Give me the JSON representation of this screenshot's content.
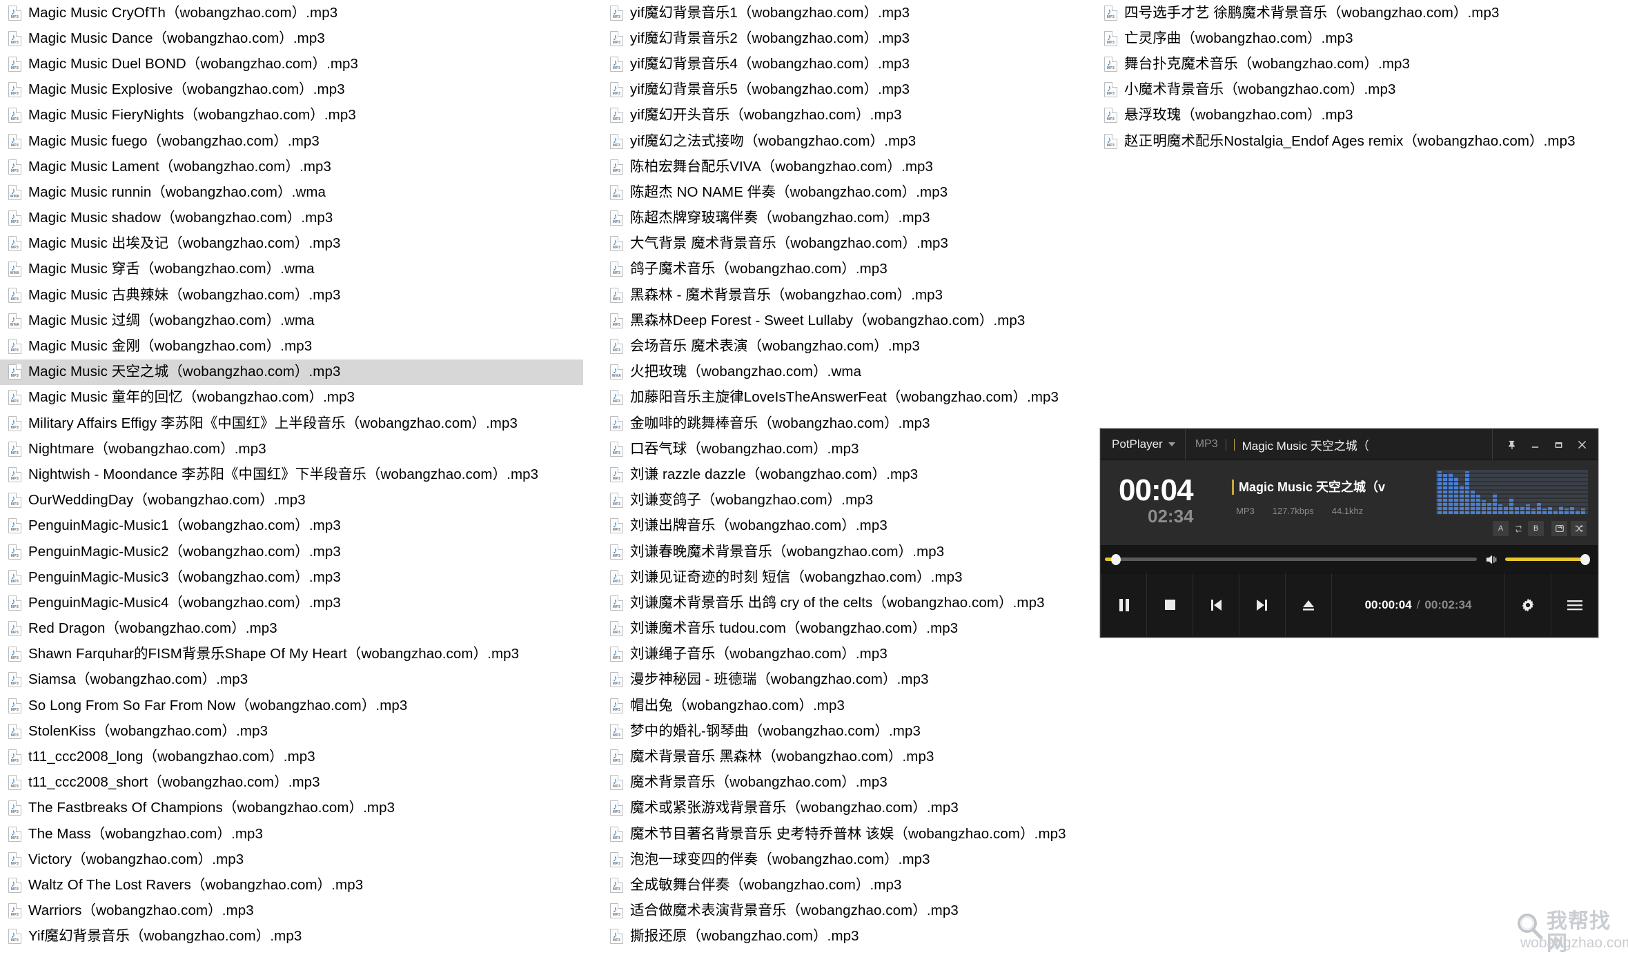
{
  "window": {
    "background_color": "#ffffff",
    "selection_color": "#d7d7d7",
    "text_color": "#000000"
  },
  "file_list": {
    "columns": [
      {
        "name": "column-1",
        "files": [
          {
            "name": "Magic Music CryOfTh（wobangzhao.com）.mp3",
            "format": "MP3",
            "selected": false
          },
          {
            "name": "Magic Music Dance（wobangzhao.com）.mp3",
            "format": "MP3",
            "selected": false
          },
          {
            "name": "Magic Music Duel BOND（wobangzhao.com）.mp3",
            "format": "MP3",
            "selected": false
          },
          {
            "name": "Magic Music Explosive（wobangzhao.com）.mp3",
            "format": "MP3",
            "selected": false
          },
          {
            "name": "Magic Music FieryNights（wobangzhao.com）.mp3",
            "format": "MP3",
            "selected": false
          },
          {
            "name": "Magic Music fuego（wobangzhao.com）.mp3",
            "format": "MP3",
            "selected": false
          },
          {
            "name": "Magic Music Lament（wobangzhao.com）.mp3",
            "format": "MP3",
            "selected": false
          },
          {
            "name": "Magic Music runnin（wobangzhao.com）.wma",
            "format": "WMA",
            "selected": false
          },
          {
            "name": "Magic Music shadow（wobangzhao.com）.mp3",
            "format": "MP3",
            "selected": false
          },
          {
            "name": "Magic Music 出埃及记（wobangzhao.com）.mp3",
            "format": "MP3",
            "selected": false
          },
          {
            "name": "Magic Music 穿舌（wobangzhao.com）.wma",
            "format": "WMA",
            "selected": false
          },
          {
            "name": "Magic Music 古典辣妹（wobangzhao.com）.mp3",
            "format": "MP3",
            "selected": false
          },
          {
            "name": "Magic Music 过绸（wobangzhao.com）.wma",
            "format": "WMA",
            "selected": false
          },
          {
            "name": "Magic Music 金刚（wobangzhao.com）.mp3",
            "format": "MP3",
            "selected": false
          },
          {
            "name": "Magic Music 天空之城（wobangzhao.com）.mp3",
            "format": "MP3",
            "selected": true
          },
          {
            "name": "Magic Music 童年的回忆（wobangzhao.com）.mp3",
            "format": "MP3",
            "selected": false
          },
          {
            "name": "Military Affairs Effigy 李苏阳《中国红》上半段音乐（wobangzhao.com）.mp3",
            "format": "MP3",
            "selected": false
          },
          {
            "name": "Nightmare（wobangzhao.com）.mp3",
            "format": "MP3",
            "selected": false
          },
          {
            "name": "Nightwish - Moondance 李苏阳《中国红》下半段音乐（wobangzhao.com）.mp3",
            "format": "MP3",
            "selected": false
          },
          {
            "name": "OurWeddingDay（wobangzhao.com）.mp3",
            "format": "MP3",
            "selected": false
          },
          {
            "name": "PenguinMagic-Music1（wobangzhao.com）.mp3",
            "format": "MP3",
            "selected": false
          },
          {
            "name": "PenguinMagic-Music2（wobangzhao.com）.mp3",
            "format": "MP3",
            "selected": false
          },
          {
            "name": "PenguinMagic-Music3（wobangzhao.com）.mp3",
            "format": "MP3",
            "selected": false
          },
          {
            "name": "PenguinMagic-Music4（wobangzhao.com）.mp3",
            "format": "MP3",
            "selected": false
          },
          {
            "name": "Red Dragon（wobangzhao.com）.mp3",
            "format": "MP3",
            "selected": false
          },
          {
            "name": "Shawn Farquhar的FISM背景乐Shape Of My Heart（wobangzhao.com）.mp3",
            "format": "MP3",
            "selected": false
          },
          {
            "name": "Siamsa（wobangzhao.com）.mp3",
            "format": "MP3",
            "selected": false
          },
          {
            "name": "So Long From So Far From Now（wobangzhao.com）.mp3",
            "format": "MP3",
            "selected": false
          },
          {
            "name": "StolenKiss（wobangzhao.com）.mp3",
            "format": "MP3",
            "selected": false
          },
          {
            "name": "t11_ccc2008_long（wobangzhao.com）.mp3",
            "format": "MP3",
            "selected": false
          },
          {
            "name": "t11_ccc2008_short（wobangzhao.com）.mp3",
            "format": "MP3",
            "selected": false
          },
          {
            "name": "The Fastbreaks Of Champions（wobangzhao.com）.mp3",
            "format": "MP3",
            "selected": false
          },
          {
            "name": "The Mass（wobangzhao.com）.mp3",
            "format": "MP3",
            "selected": false
          },
          {
            "name": "Victory（wobangzhao.com）.mp3",
            "format": "MP3",
            "selected": false
          },
          {
            "name": "Waltz Of The Lost Ravers（wobangzhao.com）.mp3",
            "format": "MP3",
            "selected": false
          },
          {
            "name": "Warriors（wobangzhao.com）.mp3",
            "format": "MP3",
            "selected": false
          },
          {
            "name": "Yif魔幻背景音乐（wobangzhao.com）.mp3",
            "format": "MP3",
            "selected": false
          }
        ]
      },
      {
        "name": "column-2",
        "files": [
          {
            "name": "yif魔幻背景音乐1（wobangzhao.com）.mp3",
            "format": "MP3",
            "selected": false
          },
          {
            "name": "yif魔幻背景音乐2（wobangzhao.com）.mp3",
            "format": "MP3",
            "selected": false
          },
          {
            "name": "yif魔幻背景音乐4（wobangzhao.com）.mp3",
            "format": "MP3",
            "selected": false
          },
          {
            "name": "yif魔幻背景音乐5（wobangzhao.com）.mp3",
            "format": "MP3",
            "selected": false
          },
          {
            "name": "yif魔幻开头音乐（wobangzhao.com）.mp3",
            "format": "MP3",
            "selected": false
          },
          {
            "name": "yif魔幻之法式接吻（wobangzhao.com）.mp3",
            "format": "MP3",
            "selected": false
          },
          {
            "name": "陈柏宏舞台配乐VIVA（wobangzhao.com）.mp3",
            "format": "MP3",
            "selected": false
          },
          {
            "name": "陈超杰 NO NAME 伴奏（wobangzhao.com）.mp3",
            "format": "MP3",
            "selected": false
          },
          {
            "name": "陈超杰牌穿玻璃伴奏（wobangzhao.com）.mp3",
            "format": "MP3",
            "selected": false
          },
          {
            "name": "大气背景 魔术背景音乐（wobangzhao.com）.mp3",
            "format": "MP3",
            "selected": false
          },
          {
            "name": "鸽子魔术音乐（wobangzhao.com）.mp3",
            "format": "MP3",
            "selected": false
          },
          {
            "name": "黑森林 - 魔术背景音乐（wobangzhao.com）.mp3",
            "format": "MP3",
            "selected": false
          },
          {
            "name": "黑森林Deep Forest - Sweet Lullaby（wobangzhao.com）.mp3",
            "format": "MP3",
            "selected": false
          },
          {
            "name": "会场音乐 魔术表演（wobangzhao.com）.mp3",
            "format": "MP3",
            "selected": false
          },
          {
            "name": "火把玫瑰（wobangzhao.com）.wma",
            "format": "WMA",
            "selected": false
          },
          {
            "name": "加藤阳音乐主旋律LoveIsTheAnswerFeat（wobangzhao.com）.mp3",
            "format": "MP3",
            "selected": false
          },
          {
            "name": "金咖啡的跳舞棒音乐（wobangzhao.com）.mp3",
            "format": "MP3",
            "selected": false
          },
          {
            "name": "口吞气球（wobangzhao.com）.mp3",
            "format": "MP3",
            "selected": false
          },
          {
            "name": "刘谦 razzle dazzle（wobangzhao.com）.mp3",
            "format": "MP3",
            "selected": false
          },
          {
            "name": "刘谦变鸽子（wobangzhao.com）.mp3",
            "format": "MP3",
            "selected": false
          },
          {
            "name": "刘谦出牌音乐（wobangzhao.com）.mp3",
            "format": "MP3",
            "selected": false
          },
          {
            "name": "刘谦春晚魔术背景音乐（wobangzhao.com）.mp3",
            "format": "MP3",
            "selected": false
          },
          {
            "name": "刘谦见证奇迹的时刻 短信（wobangzhao.com）.mp3",
            "format": "MP3",
            "selected": false
          },
          {
            "name": "刘谦魔术背景音乐 出鸽 cry of the celts（wobangzhao.com）.mp3",
            "format": "MP3",
            "selected": false
          },
          {
            "name": "刘谦魔术音乐 tudou.com（wobangzhao.com）.mp3",
            "format": "MP3",
            "selected": false
          },
          {
            "name": "刘谦绳子音乐（wobangzhao.com）.mp3",
            "format": "MP3",
            "selected": false
          },
          {
            "name": "漫步神秘园 - 班德瑞（wobangzhao.com）.mp3",
            "format": "MP3",
            "selected": false
          },
          {
            "name": "帽出兔（wobangzhao.com）.mp3",
            "format": "MP3",
            "selected": false
          },
          {
            "name": "梦中的婚礼-钢琴曲（wobangzhao.com）.mp3",
            "format": "MP3",
            "selected": false
          },
          {
            "name": "魔术背景音乐 黑森林（wobangzhao.com）.mp3",
            "format": "MP3",
            "selected": false
          },
          {
            "name": "魔术背景音乐（wobangzhao.com）.mp3",
            "format": "MP3",
            "selected": false
          },
          {
            "name": "魔术或紧张游戏背景音乐（wobangzhao.com）.mp3",
            "format": "MP3",
            "selected": false
          },
          {
            "name": "魔术节目著名背景音乐 史考特乔普林 该娱（wobangzhao.com）.mp3",
            "format": "MP3",
            "selected": false
          },
          {
            "name": "泡泡一球变四的伴奏（wobangzhao.com）.mp3",
            "format": "MP3",
            "selected": false
          },
          {
            "name": "全成敏舞台伴奏（wobangzhao.com）.mp3",
            "format": "MP3",
            "selected": false
          },
          {
            "name": "适合做魔术表演背景音乐（wobangzhao.com）.mp3",
            "format": "MP3",
            "selected": false
          },
          {
            "name": "撕报还原（wobangzhao.com）.mp3",
            "format": "MP3",
            "selected": false
          }
        ]
      },
      {
        "name": "column-3",
        "files": [
          {
            "name": "四号选手才艺 徐鹏魔术背景音乐（wobangzhao.com）.mp3",
            "format": "MP3",
            "selected": false
          },
          {
            "name": "亡灵序曲（wobangzhao.com）.mp3",
            "format": "MP3",
            "selected": false
          },
          {
            "name": "舞台扑克魔术音乐（wobangzhao.com）.mp3",
            "format": "MP3",
            "selected": false
          },
          {
            "name": "小魔术背景音乐（wobangzhao.com）.mp3",
            "format": "MP3",
            "selected": false
          },
          {
            "name": "悬浮玫瑰（wobangzhao.com）.mp3",
            "format": "MP3",
            "selected": false
          },
          {
            "name": "赵正明魔术配乐Nostalgia_Endof Ages remix（wobangzhao.com）.mp3",
            "format": "MP3",
            "selected": false
          }
        ]
      }
    ]
  },
  "potplayer": {
    "brand": "PotPlayer",
    "titlebar": {
      "format": "MP3",
      "title": "Magic Music 天空之城（",
      "pin_icon": "pin-icon",
      "minimize_icon": "minimize-icon",
      "maximize_icon": "maximize-icon",
      "close_icon": "close-icon"
    },
    "info": {
      "elapsed": "00:04",
      "duration": "02:34",
      "track_title": "Magic Music 天空之城（v",
      "codec": "MP3",
      "bitrate": "127.7kbps",
      "samplerate": "44.1khz",
      "ab_a": "A",
      "ab_b": "B",
      "repeat_icon": "repeat-icon",
      "shuffle_icon": "shuffle-icon",
      "ab_loop_icon": "ab-loop-icon",
      "visualizer_color": "#4a7fd4"
    },
    "seek": {
      "progress_percent": 2.6,
      "volume_percent": 100,
      "accent_color": "#e8c72b"
    },
    "controls": {
      "play_pause_icon": "pause-icon",
      "stop_icon": "stop-icon",
      "previous_icon": "previous-icon",
      "next_icon": "next-icon",
      "eject_icon": "eject-icon",
      "current_time": "00:00:04",
      "time_separator": "/",
      "total_time": "00:02:34",
      "settings_icon": "gear-icon",
      "menu_icon": "hamburger-menu-icon"
    }
  },
  "watermark": {
    "cn_text": "我帮找网",
    "url_text": "wobangzhao.com",
    "icon": "magnifier-icon"
  }
}
